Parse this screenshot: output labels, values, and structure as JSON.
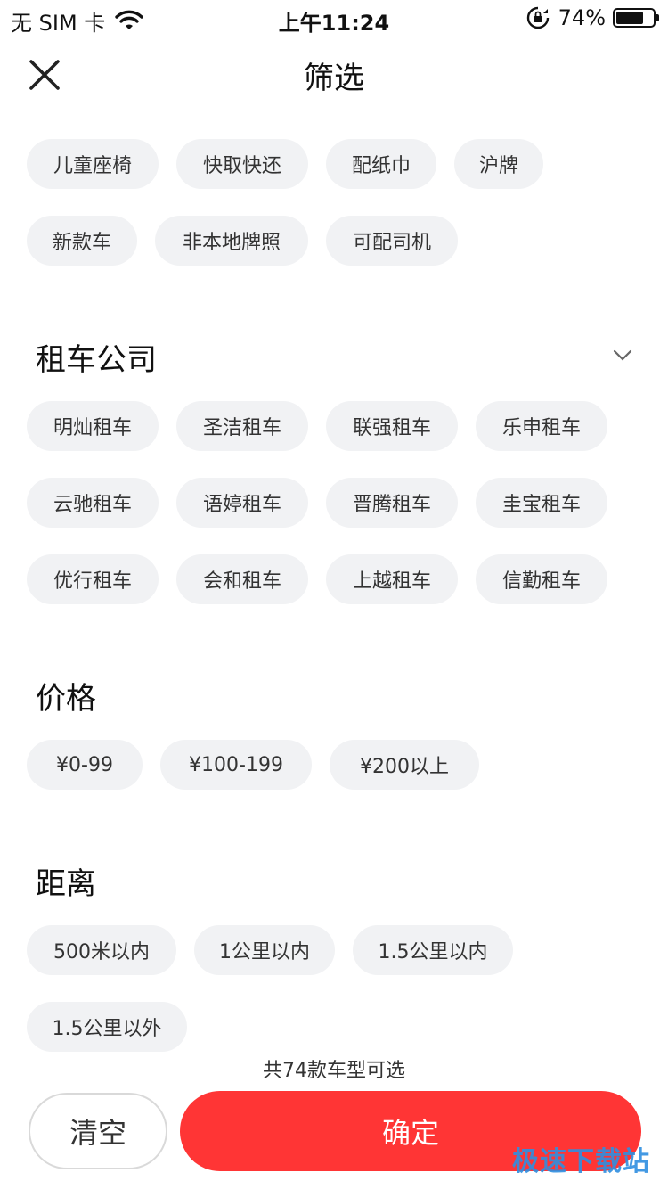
{
  "status_bar": {
    "carrier": "无 SIM 卡",
    "time": "上午11:24",
    "battery_pct": "74%",
    "battery_level": 0.74,
    "icons": [
      "wifi-icon",
      "orientation-lock-icon",
      "battery-icon"
    ]
  },
  "header": {
    "title": "筛选",
    "close_icon": "close-icon"
  },
  "features": {
    "row1": [
      "儿童座椅",
      "快取快还",
      "配纸巾",
      "沪牌"
    ],
    "row2": [
      "新款车",
      "非本地牌照",
      "可配司机"
    ]
  },
  "companies": {
    "title": "租车公司",
    "expand_icon": "chevron-down-icon",
    "row1": [
      "明灿租车",
      "圣洁租车",
      "联强租车",
      "乐申租车"
    ],
    "row2": [
      "云驰租车",
      "语婷租车",
      "晋腾租车",
      "圭宝租车"
    ],
    "row3": [
      "优行租车",
      "会和租车",
      "上越租车",
      "信勤租车"
    ]
  },
  "price": {
    "title": "价格",
    "options": [
      "¥0-99",
      "¥100-199",
      "¥200以上"
    ]
  },
  "distance": {
    "title": "距离",
    "row1": [
      "500米以内",
      "1公里以内",
      "1.5公里以内"
    ],
    "row2": [
      "1.5公里以外"
    ]
  },
  "footer": {
    "count_text": "共74款车型可选",
    "clear_label": "清空",
    "confirm_label": "确定"
  },
  "watermark": "极速下载站",
  "colors": {
    "accent": "#ff3535",
    "chip_bg": "#f1f2f4",
    "watermark": "#2f8fe0"
  }
}
